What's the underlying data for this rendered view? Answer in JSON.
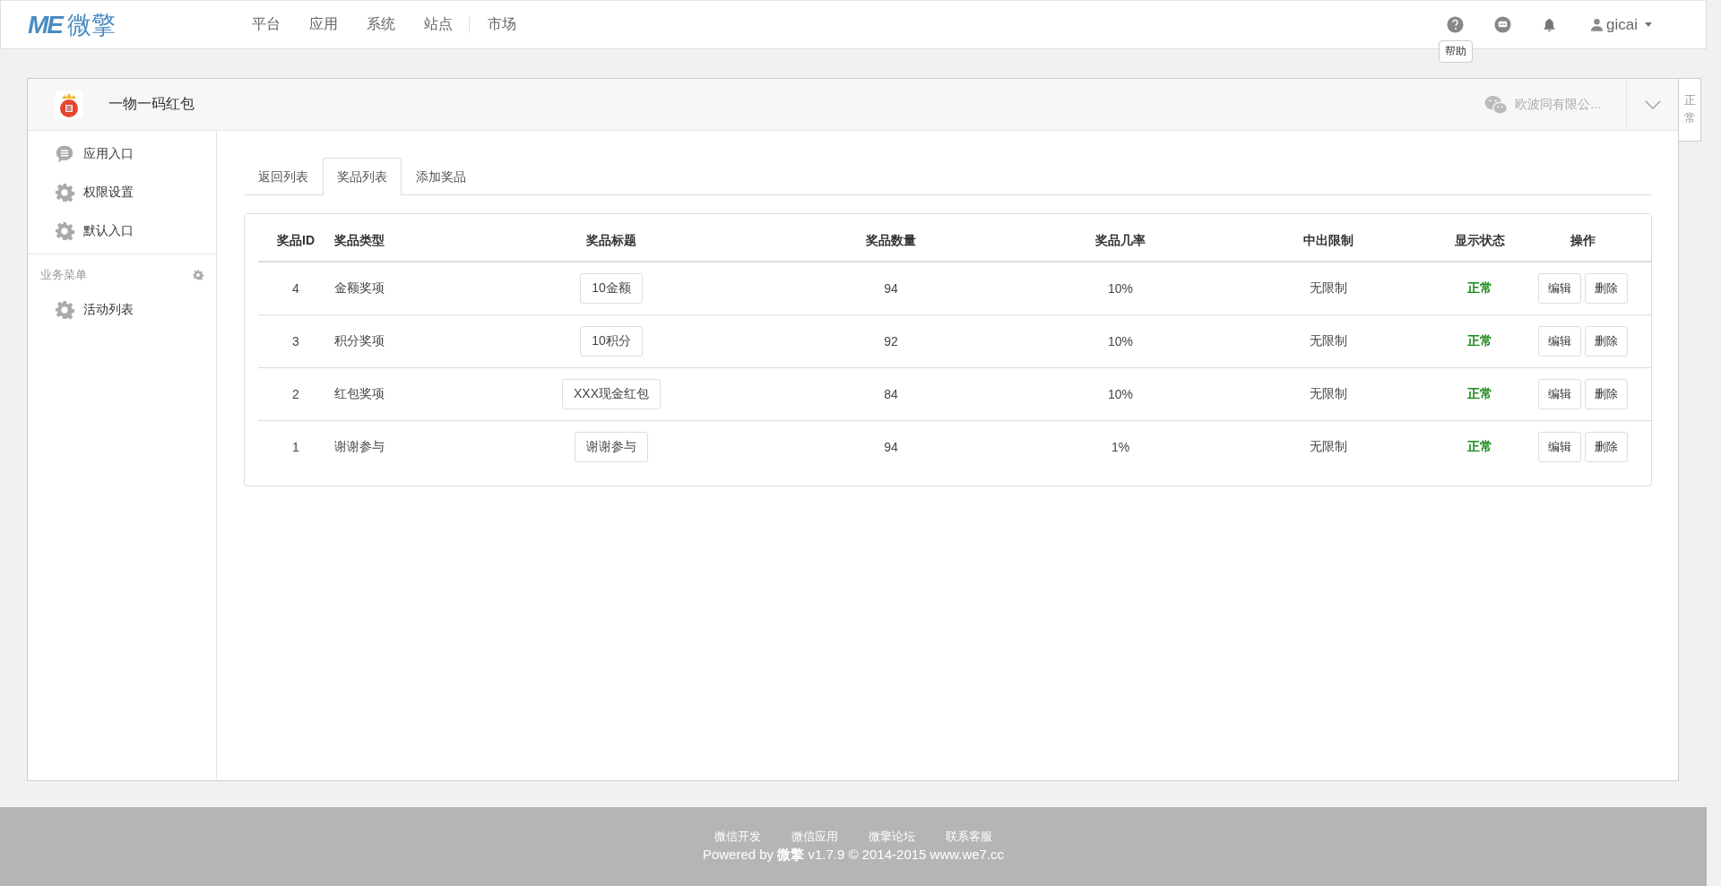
{
  "top_bar": {
    "logo_mark": "ME",
    "logo_text": "微擎",
    "nav": [
      [
        "平台",
        "应用",
        "系统",
        "站点"
      ],
      [
        "市场"
      ]
    ],
    "user": "gicai",
    "tooltip": "帮助"
  },
  "app": {
    "name": "一物一码红包",
    "account": "欧波同有限公...",
    "side_tab": "正常"
  },
  "sidebar": {
    "items": [
      {
        "label": "应用入口",
        "kind": "chat"
      },
      {
        "label": "权限设置",
        "kind": "gear"
      },
      {
        "label": "默认入口",
        "kind": "gear"
      }
    ],
    "section": {
      "title": "业务菜单",
      "items": [
        {
          "label": "活动列表",
          "kind": "gear"
        }
      ]
    }
  },
  "tabs": [
    {
      "label": "返回列表",
      "selected": false
    },
    {
      "label": "奖品列表",
      "selected": true
    },
    {
      "label": "添加奖品",
      "selected": false
    }
  ],
  "table": {
    "columns": [
      "奖品ID",
      "奖品类型",
      "奖品标题",
      "奖品数量",
      "奖品几率",
      "中出限制",
      "显示状态",
      "操作"
    ],
    "rows": [
      {
        "id": "4",
        "type": "金额奖项",
        "title": "10金额",
        "quantity": "94",
        "rate": "10%",
        "limit": "无限制",
        "status": "正常",
        "actions": [
          "编辑",
          "删除"
        ]
      },
      {
        "id": "3",
        "type": "积分奖项",
        "title": "10积分",
        "quantity": "92",
        "rate": "10%",
        "limit": "无限制",
        "status": "正常",
        "actions": [
          "编辑",
          "删除"
        ]
      },
      {
        "id": "2",
        "type": "红包奖项",
        "title": "XXX现金红包",
        "quantity": "84",
        "rate": "10%",
        "limit": "无限制",
        "status": "正常",
        "actions": [
          "编辑",
          "删除"
        ]
      },
      {
        "id": "1",
        "type": "谢谢参与",
        "title": "谢谢参与",
        "quantity": "94",
        "rate": "1%",
        "limit": "无限制",
        "status": "正常",
        "actions": [
          "编辑",
          "删除"
        ]
      }
    ]
  },
  "footer": {
    "links": [
      "微信开发",
      "微信应用",
      "微擎论坛",
      "联系客服"
    ],
    "copyright": "Powered by **微擎** v1.7.9 © 2014-2015 www.we7.cc"
  }
}
